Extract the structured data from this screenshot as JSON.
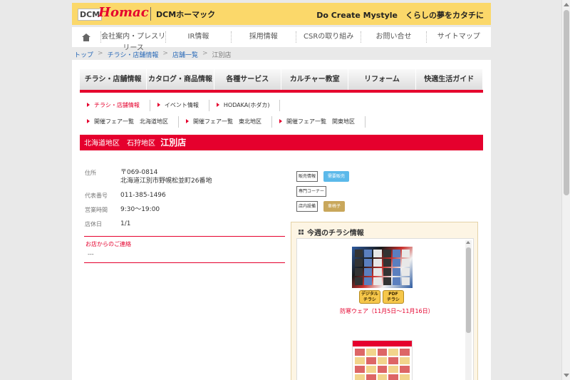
{
  "header": {
    "logo_dcm": "DCM",
    "logo_homac": "Homac",
    "logo_dcm2": "DCMホーマック",
    "tagline": "Do Create Mystyle　くらしの夢をカタチに"
  },
  "gnav": {
    "items": [
      "会社案内・プレスリリース",
      "IR情報",
      "採用情報",
      "CSRの取り組み",
      "お問い合せ",
      "サイトマップ"
    ]
  },
  "breadcrumb": {
    "items": [
      "トップ",
      "チラシ・店舗情報",
      "店舗一覧",
      "江別店"
    ],
    "sep": ">"
  },
  "category_nav": {
    "items": [
      "チラシ・店舗情報",
      "カタログ・商品情報",
      "各種サービス",
      "カルチャー教室",
      "リフォーム",
      "快適生活ガイド"
    ]
  },
  "subnav1": {
    "items": [
      "チラシ・店舗情報",
      "イベント情報",
      "HODAKA(ホダカ)"
    ]
  },
  "subnav2": {
    "items": [
      "開催フェア一覧　北海道地区",
      "開催フェア一覧　東北地区",
      "開催フェア一覧　関東地区"
    ]
  },
  "store": {
    "region": "北海道地区　石狩地区",
    "name": "江別店",
    "address_label": "住所",
    "postal": "〒069-0814",
    "address": "北海道江別市野幌松並町26番地",
    "phone_label": "代表番号",
    "phone": "011-385-1496",
    "hours_label": "営業時間",
    "hours": "9:30〜19:00",
    "closed_label": "店休日",
    "closed": "1/1",
    "contact_title": "お店からのご連絡",
    "contact_body": "---"
  },
  "tags": {
    "sales_info": "販売情報",
    "sales_pill": "需要販売",
    "specialty": "専門コーナー",
    "facility": "店内設備",
    "facility_pill": "車椅子"
  },
  "flyers": {
    "title": "今週のチラシ情報",
    "digital_btn_1": "デジタル",
    "digital_btn_2": "チラシ",
    "pdf_btn_1": "PDF",
    "pdf_btn_2": "チラシ",
    "caption": "防寒ウェア（11月5日〜11月16日）"
  }
}
